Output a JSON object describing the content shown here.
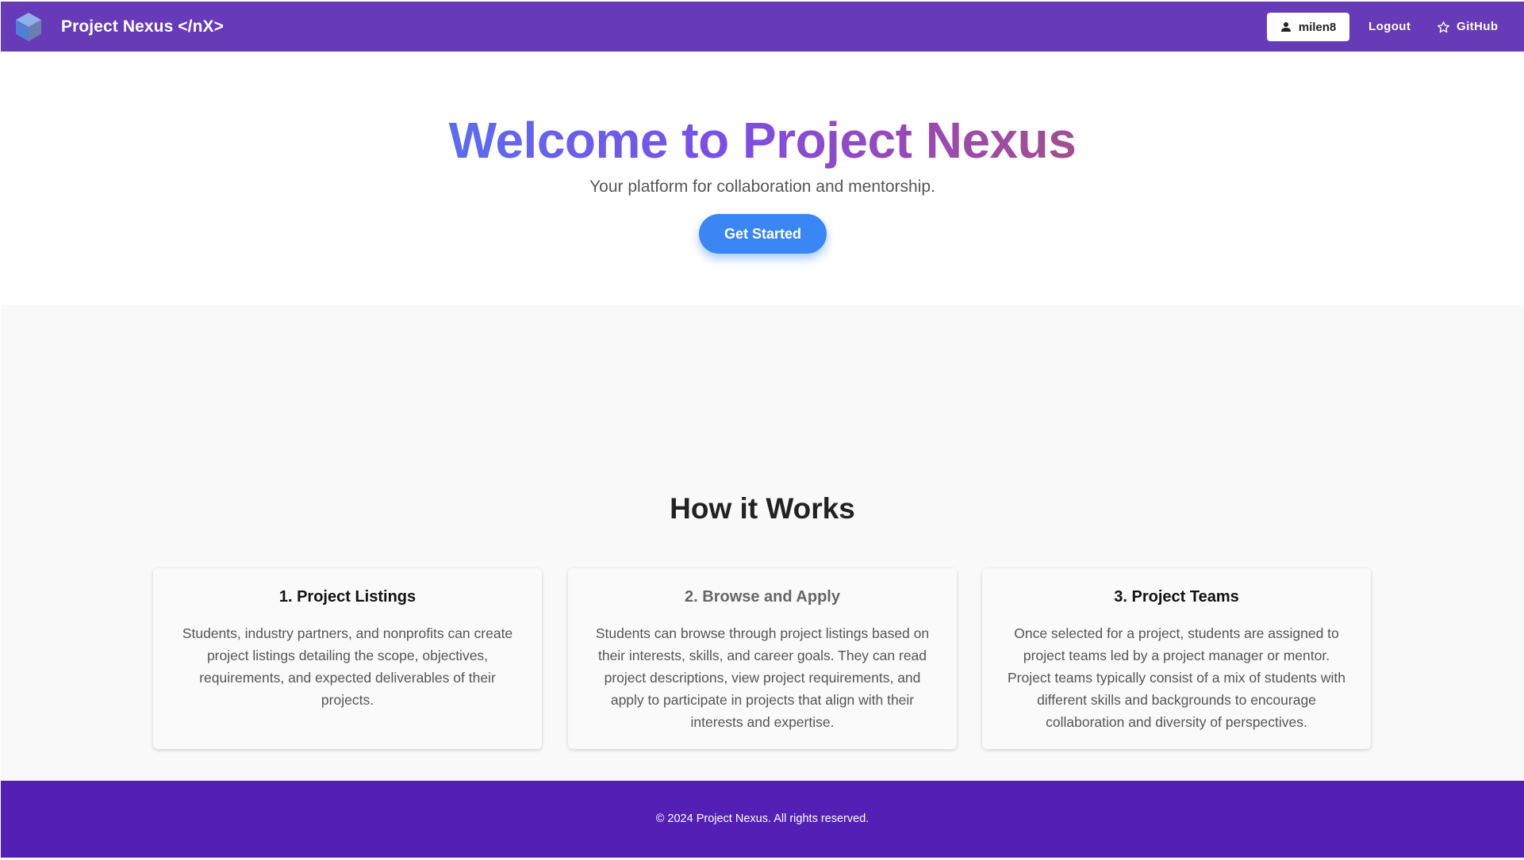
{
  "header": {
    "brand": "Project Nexus </nX>",
    "user_label": "milen8",
    "logout_label": "Logout",
    "github_label": "GitHub",
    "bar_color": "#673ab7"
  },
  "hero": {
    "title": "Welcome to Project Nexus",
    "subtitle": "Your platform for collaboration and mentorship.",
    "cta_label": "Get Started",
    "cta_color": "#3a86f5"
  },
  "how": {
    "title": "How it Works",
    "cards": [
      {
        "title": "1. Project Listings",
        "text": "Students, industry partners, and nonprofits can create project listings detailing the scope, objectives, requirements, and expected deliverables of their projects."
      },
      {
        "title": "2. Browse and Apply",
        "text": "Students can browse through project listings based on their interests, skills, and career goals. They can read project descriptions, view project requirements, and apply to participate in projects that align with their interests and expertise."
      },
      {
        "title": "3. Project Teams",
        "text": "Once selected for a project, students are assigned to project teams led by a project manager or mentor. Project teams typically consist of a mix of students with different skills and backgrounds to encourage collaboration and diversity of perspectives."
      }
    ]
  },
  "footer": {
    "text": "© 2024 Project Nexus. All rights reserved.",
    "color": "#531fb5"
  },
  "icons": {
    "logo": "cube-logo-icon",
    "user": "person-icon",
    "github": "star-icon"
  }
}
